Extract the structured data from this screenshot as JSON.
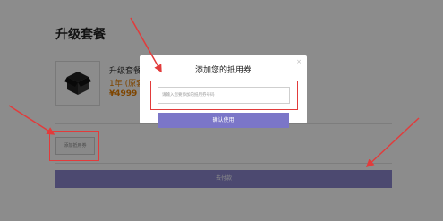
{
  "page": {
    "section_title": "升级套餐",
    "product": {
      "name": "升级套餐",
      "duration": "1年 (原套",
      "price": "¥4999"
    },
    "add_coupon_label": "添加抵用券",
    "pay_label": "去付款"
  },
  "modal": {
    "title": "添加您的抵用券",
    "close": "×",
    "input_placeholder": "请输入您要添加的抵用券号码",
    "confirm_label": "确认使用"
  },
  "colors": {
    "accent": "#7b76c8",
    "price": "#e67e00",
    "annotation": "#e23b3b",
    "overlay": "#8a8a8a"
  },
  "icons": {
    "product": "open-box-icon",
    "close": "close-icon"
  }
}
